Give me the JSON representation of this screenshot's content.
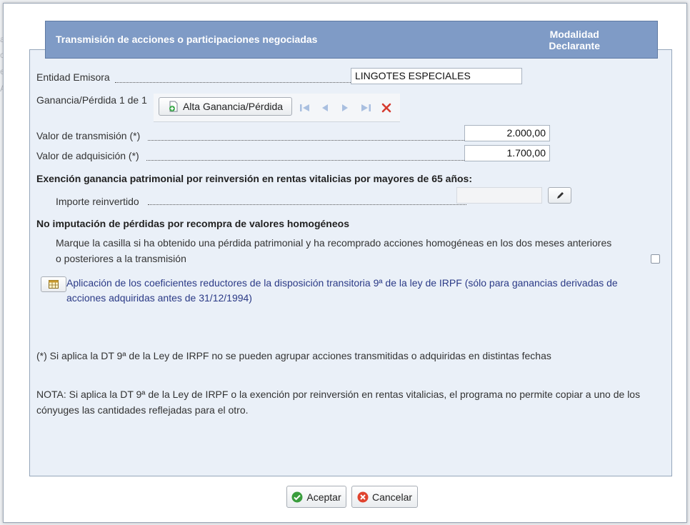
{
  "background": {
    "fragment_left_a": "a",
    "fragment_left_o": "o",
    "fragment_left_e": "e",
    "fragment_left_A": "A"
  },
  "header": {
    "title": "Transmisión de acciones o participaciones negociadas",
    "modalidad_line1": "Modalidad",
    "modalidad_line2": "Declarante"
  },
  "entidad": {
    "label": "Entidad Emisora",
    "value": "LINGOTES ESPECIALES"
  },
  "ganancia": {
    "label": "Ganancia/Pérdida 1 de 1",
    "alta_button": "Alta Ganancia/Pérdida"
  },
  "valor_transmision": {
    "label": "Valor de transmisión (*)",
    "value": "2.000,00"
  },
  "valor_adquisicion": {
    "label": "Valor de adquisición (*)",
    "value": "1.700,00"
  },
  "exencion": {
    "heading": "Exención ganancia patrimonial por reinversión en rentas vitalicias por mayores de 65 años:",
    "importe_label": "Importe reinvertido",
    "importe_value": ""
  },
  "no_imputacion": {
    "heading": "No imputación de pérdidas por recompra de valores homogéneos",
    "text_line1": "Marque la casilla si ha obtenido una pérdida patrimonial y ha recomprado acciones homogéneas en los dos meses anteriores",
    "text_line2": "o posteriores a la transmisión",
    "checked": false
  },
  "coeficientes": {
    "link_line1": "Aplicación de los coeficientes reductores de la disposición transitoria 9ª de la ley de IRPF (sólo para ganancias derivadas de",
    "link_line2": "acciones adquiridas antes de 31/12/1994)"
  },
  "notes": {
    "asterisk_note": "(*) Si aplica la DT 9ª de la Ley de IRPF no se pueden agrupar acciones transmitidas o adquiridas en distintas fechas",
    "nota_line1": "NOTA: Si aplica la DT 9ª de la Ley de IRPF o la exención por reinversión en rentas vitalicias, el programa no permite copiar a uno de los",
    "nota_line2": "cónyuges las cantidades reflejadas para el otro."
  },
  "footer": {
    "accept_label": "Aceptar",
    "cancel_label": "Cancelar"
  },
  "colors": {
    "header_bg": "#7f9bc6",
    "panel_bg": "#eaf0f8",
    "link": "#2b3a86",
    "delete_red": "#d63b2f"
  },
  "icons": {
    "add": "add-document-icon",
    "first": "first-record-icon",
    "prev": "previous-record-icon",
    "next": "next-record-icon",
    "last": "last-record-icon",
    "delete": "delete-icon",
    "edit": "pencil-icon",
    "table": "table-icon",
    "accept": "check-icon",
    "cancel": "cancel-icon"
  }
}
